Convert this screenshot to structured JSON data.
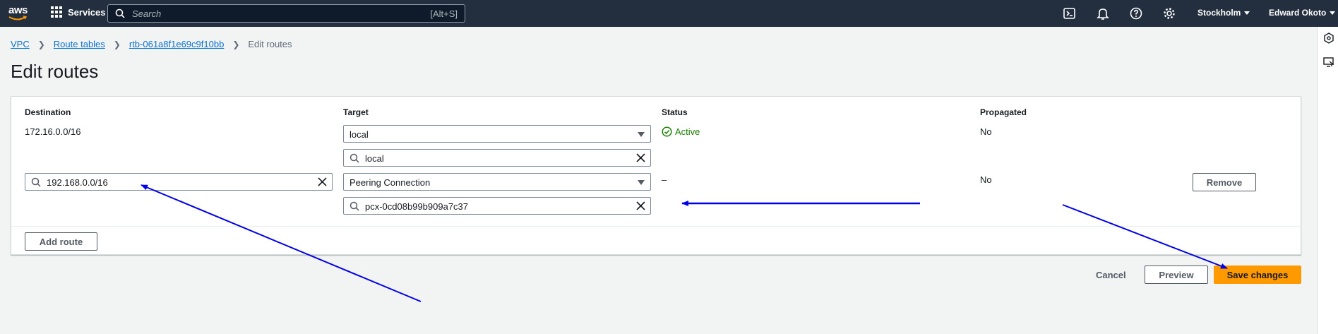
{
  "nav": {
    "logo_text": "aws",
    "services_label": "Services",
    "search_placeholder": "Search",
    "search_shortcut": "[Alt+S]",
    "region": "Stockholm",
    "user": "Edward Okoto"
  },
  "breadcrumb": {
    "items": [
      "VPC",
      "Route tables",
      "rtb-061a8f1e69c9f10bb"
    ],
    "current": "Edit routes"
  },
  "page_title": "Edit routes",
  "table": {
    "headers": {
      "destination": "Destination",
      "target": "Target",
      "status": "Status",
      "propagated": "Propagated"
    },
    "rows": [
      {
        "destination": "172.16.0.0/16",
        "target_type": "local",
        "target_value": "local",
        "status": "Active",
        "propagated": "No"
      },
      {
        "destination": "192.168.0.0/16",
        "target_type": "Peering Connection",
        "target_value": "pcx-0cd08b99b909a7c37",
        "status": "–",
        "propagated": "No",
        "remove_label": "Remove"
      }
    ]
  },
  "buttons": {
    "add_route": "Add route",
    "cancel": "Cancel",
    "preview": "Preview",
    "save": "Save changes"
  },
  "colors": {
    "nav_bg": "#232f3e",
    "link": "#0972d3",
    "active_status": "#1d8102",
    "primary": "#ff9900",
    "annotation_arrow": "#0000e6"
  }
}
